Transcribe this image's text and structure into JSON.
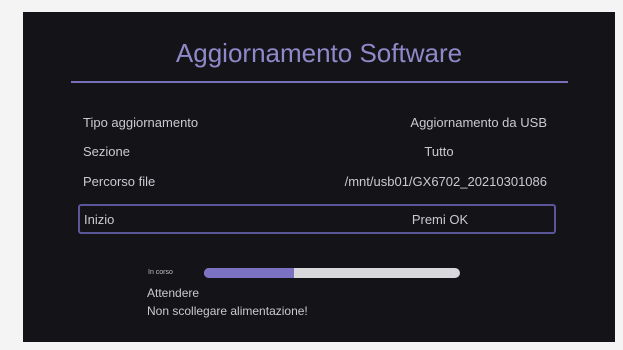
{
  "screen": {
    "title": "Aggiornamento Software"
  },
  "settings": [
    {
      "label": "Tipo aggiornamento",
      "value": "Aggiornamento da USB"
    },
    {
      "label": "Sezione",
      "value": "Tutto"
    },
    {
      "label": "Percorso file",
      "value": "/mnt/usb01/GX6702_20210301086"
    },
    {
      "label": "Inizio",
      "value": "Premi OK"
    }
  ],
  "progress": {
    "label": "In corso",
    "fraction": 0.35,
    "fill_color": "#7b72c2",
    "track_color": "#d9d9dc"
  },
  "messages": [
    "Attendere",
    "Non scollegare alimentazione!"
  ],
  "colors": {
    "accent": "#8f88c9",
    "background": "#141418",
    "text": "#c9c9cf"
  }
}
